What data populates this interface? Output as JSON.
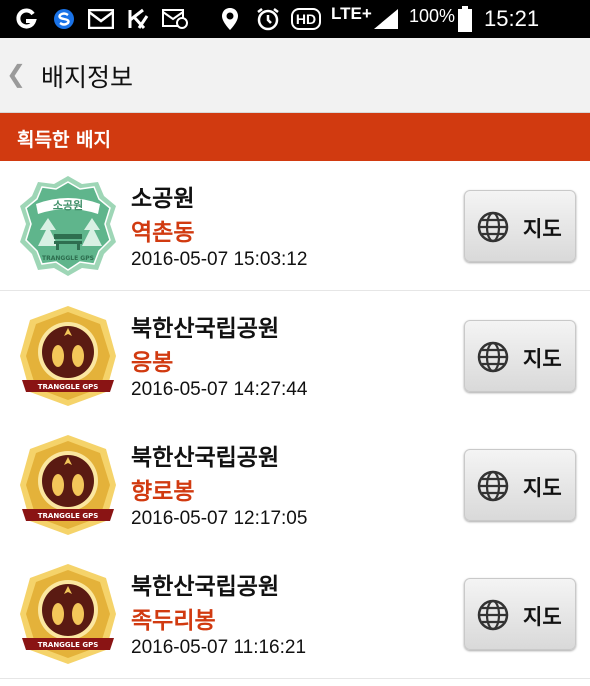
{
  "status_bar": {
    "lte": "LTE+",
    "battery": "100%",
    "time": "15:21",
    "hd": "HD"
  },
  "header": {
    "back_glyph": "❮",
    "title": "배지정보"
  },
  "section": {
    "title": "획득한 배지"
  },
  "badges": [
    {
      "badge_type": "green-park-badge",
      "badge_text": "소공원",
      "badge_footer": "TRANGGLE GPS",
      "place": "소공원",
      "spot": "역촌동",
      "datetime": "2016-05-07 15:03:12",
      "map_label": "지도"
    },
    {
      "badge_type": "gold-mountain-badge",
      "badge_footer": "TRANGGLE GPS",
      "place": "북한산국립공원",
      "spot": "응봉",
      "datetime": "2016-05-07 14:27:44",
      "map_label": "지도"
    },
    {
      "badge_type": "gold-mountain-badge",
      "badge_footer": "TRANGGLE GPS",
      "place": "북한산국립공원",
      "spot": "향로봉",
      "datetime": "2016-05-07 12:17:05",
      "map_label": "지도"
    },
    {
      "badge_type": "gold-mountain-badge",
      "badge_footer": "TRANGGLE GPS",
      "place": "북한산국립공원",
      "spot": "족두리봉",
      "datetime": "2016-05-07 11:16:21",
      "map_label": "지도"
    }
  ],
  "colors": {
    "accent": "#d13a10",
    "green_badge": "#5fb58c",
    "gold_badge": "#e4b23a"
  }
}
